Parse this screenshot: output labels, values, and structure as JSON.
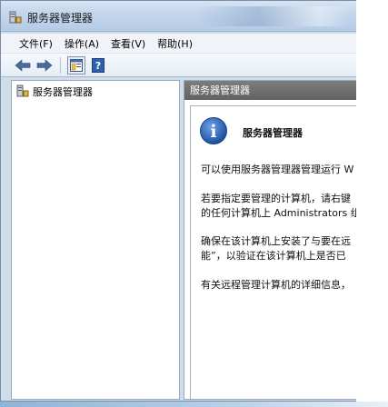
{
  "window": {
    "title": "服务器管理器",
    "app_icon": "server-manager-icon"
  },
  "menubar": {
    "items": [
      {
        "label": "文件(F)"
      },
      {
        "label": "操作(A)"
      },
      {
        "label": "查看(V)"
      },
      {
        "label": "帮助(H)"
      }
    ]
  },
  "toolbar": {
    "icons": [
      "back-arrow-icon",
      "forward-arrow-icon",
      "show-hide-console-tree-icon",
      "help-icon"
    ],
    "help_glyph": "?"
  },
  "tree": {
    "items": [
      {
        "label": "服务器管理器",
        "icon": "server-manager-icon"
      }
    ]
  },
  "content": {
    "header": "服务器管理器",
    "info": {
      "icon": "info-icon",
      "icon_glyph": "i",
      "title": "服务器管理器",
      "paragraphs": [
        [
          "可以使用服务器管理器管理运行 W"
        ],
        [
          "若要指定要管理的计算机，请右键",
          "的任何计算机上 Administrators 组"
        ],
        [
          "确保在该计算机上安装了与要在远",
          "能”，以验证在该计算机上是否已"
        ],
        [
          "有关远程管理计算机的详细信息，"
        ]
      ]
    }
  },
  "colors": {
    "header_gray": "#6f6f6f",
    "info_blue": "#1f5fb8",
    "frame_blue": "#cfdcea"
  }
}
